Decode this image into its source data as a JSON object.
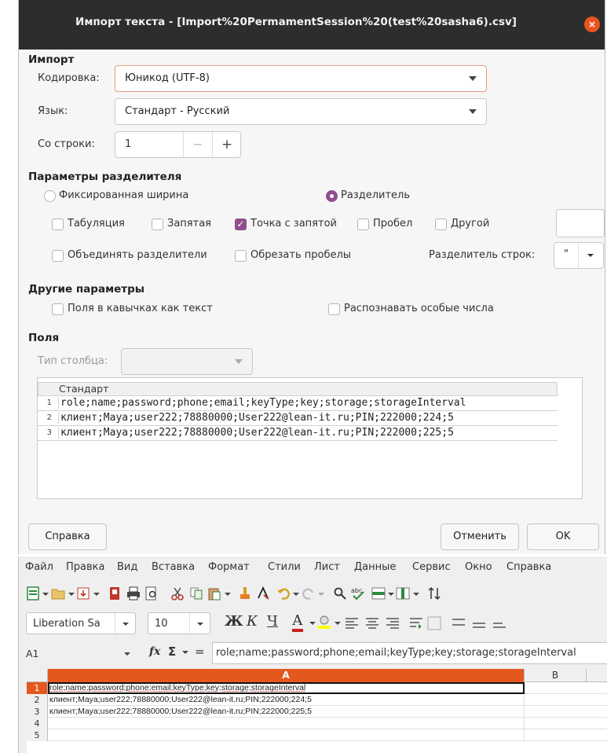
{
  "dialog": {
    "title": "Импорт текста - [Import%20PermamentSession%20(test%20sasha6).csv]",
    "close_label": "×",
    "import_section": "Импорт",
    "encoding_label": "Кодировка:",
    "encoding_value": "Юникод (UTF-8)",
    "language_label": "Язык:",
    "language_value": "Стандарт - Русский",
    "from_row_label": "Со строки:",
    "from_row_value": "1",
    "minus_label": "−",
    "plus_label": "+",
    "separator_section": "Параметры разделителя",
    "fixed_width_label": "Фиксированная ширина",
    "separated_label": "Разделитель",
    "tab_label": "Табуляция",
    "comma_label": "Запятая",
    "semicolon_label": "Точка с запятой",
    "space_label": "Пробел",
    "other_label": "Другой",
    "merge_label": "Объединять разделители",
    "trim_label": "Обрезать пробелы",
    "string_delim_label": "Разделитель строк:",
    "string_delim_value": "\"",
    "other_section": "Другие параметры",
    "quoted_label": "Поля в кавычках как текст",
    "special_numbers_label": "Распознавать особые числа",
    "fields_section": "Поля",
    "column_type_label": "Тип столбца:",
    "preview_header": "Стандарт",
    "preview_rows": [
      {
        "num": "1",
        "text": "role;name;password;phone;email;keyType;key;storage;storageInterval"
      },
      {
        "num": "2",
        "text": "клиент;Maya;user222;78880000;User222@lean-it.ru;PIN;222000;224;5"
      },
      {
        "num": "3",
        "text": "клиент;Maya;user222;78880000;User222@lean-it.ru;PIN;222000;225;5"
      }
    ],
    "help_button": "Справка",
    "cancel_button": "Отменить",
    "ok_button": "OK"
  },
  "calc": {
    "menu": [
      "Файл",
      "Правка",
      "Вид",
      "Вставка",
      "Формат",
      "Стили",
      "Лист",
      "Данные",
      "Сервис",
      "Окно",
      "Справка"
    ],
    "font_name": "Liberation Sa",
    "font_size": "10",
    "bold": "Ж",
    "italic": "К",
    "underline": "Ч",
    "font_color": "А",
    "cell_ref": "A1",
    "fx": "fx",
    "sigma": "Σ",
    "equals": "=",
    "formula": "role;name;password;phone;email;keyType;key;storage;storageInterval",
    "col_a": "A",
    "col_b": "B",
    "rows": [
      {
        "n": "1",
        "text": "role;name;password;phone;email;keyType;key;storage;storageInterval"
      },
      {
        "n": "2",
        "text": "клиент;Maya;user222;78880000;User222@lean-it.ru;PIN;222000;224;5"
      },
      {
        "n": "3",
        "text": "клиент;Maya;user222;78880000;User222@lean-it.ru;PIN;222000;225;5"
      },
      {
        "n": "4",
        "text": ""
      },
      {
        "n": "5",
        "text": ""
      }
    ],
    "colors": {
      "accent": "#e4581e",
      "checkbox": "#924d8b"
    }
  }
}
